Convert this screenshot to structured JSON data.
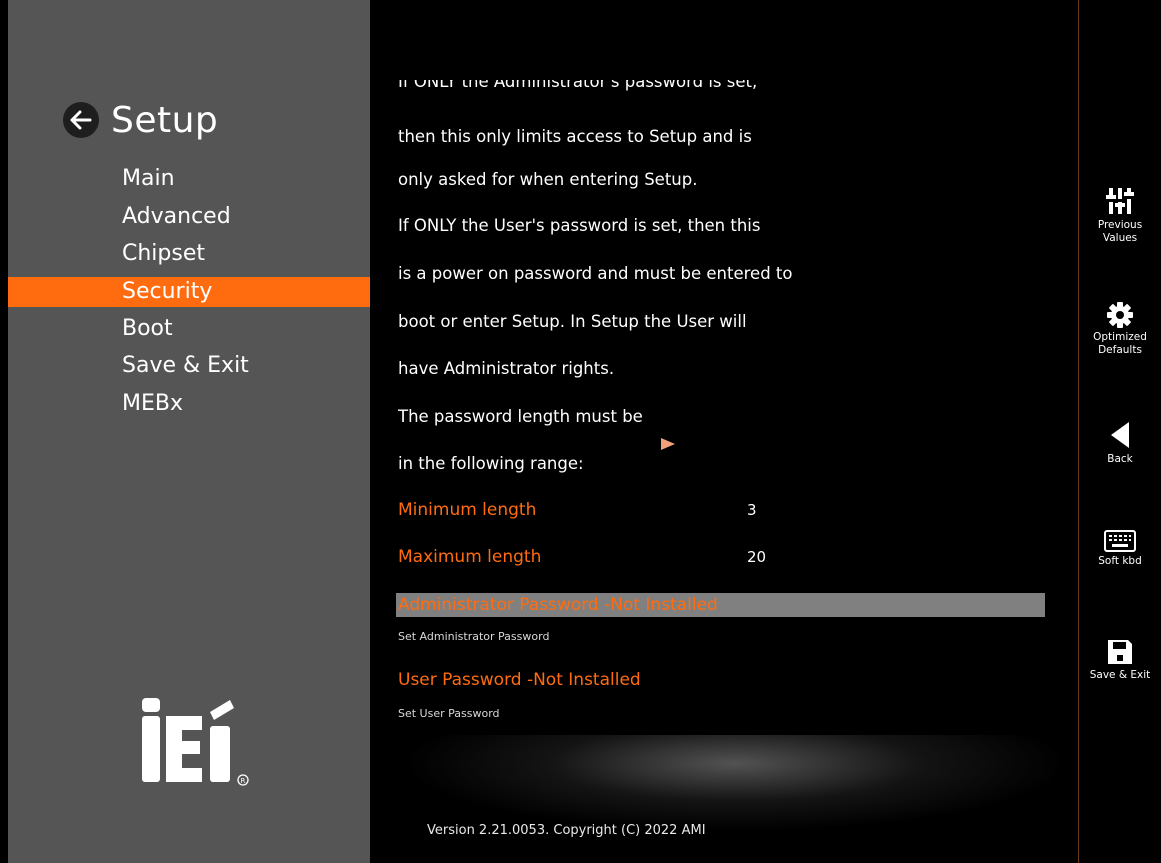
{
  "sidebar": {
    "title": "Setup",
    "items": [
      {
        "label": "Main",
        "active": false
      },
      {
        "label": "Advanced",
        "active": false
      },
      {
        "label": "Chipset",
        "active": false
      },
      {
        "label": "Security",
        "active": true
      },
      {
        "label": "Boot",
        "active": false
      },
      {
        "label": "Save & Exit",
        "active": false
      },
      {
        "label": "MEBx",
        "active": false
      }
    ],
    "logo_text": "iEi"
  },
  "help": {
    "lines": [
      "If ONLY the Administrator's password is set,",
      "then this only limits access to Setup and is",
      "only asked for when entering Setup.",
      "If ONLY the User's password is set, then this",
      "is a power on password and must be entered to",
      "boot or enter Setup. In Setup the User will",
      "have Administrator rights.",
      "The password length must be",
      "in the following range:"
    ]
  },
  "settings": {
    "min_length_label": "Minimum length",
    "min_length_value": "3",
    "max_length_label": "Maximum length",
    "max_length_value": "20",
    "admin_password_label": "Administrator Password -Not Installed",
    "admin_password_help": "Set Administrator Password",
    "user_password_label": "User Password -Not Installed",
    "user_password_help": "Set User Password"
  },
  "footer": {
    "version": "Version 2.21.0053. Copyright (C) 2022 AMI"
  },
  "actions": {
    "previous_values": [
      "Previous",
      "Values"
    ],
    "optimized_defaults": [
      "Optimized",
      "Defaults"
    ],
    "back": "Back",
    "soft_kbd": "Soft kbd",
    "save_exit": "Save & Exit"
  },
  "colors": {
    "accent": "#ff6c10",
    "sidebar_bg": "#555555",
    "selection_bg": "#808080",
    "background": "#000000"
  }
}
